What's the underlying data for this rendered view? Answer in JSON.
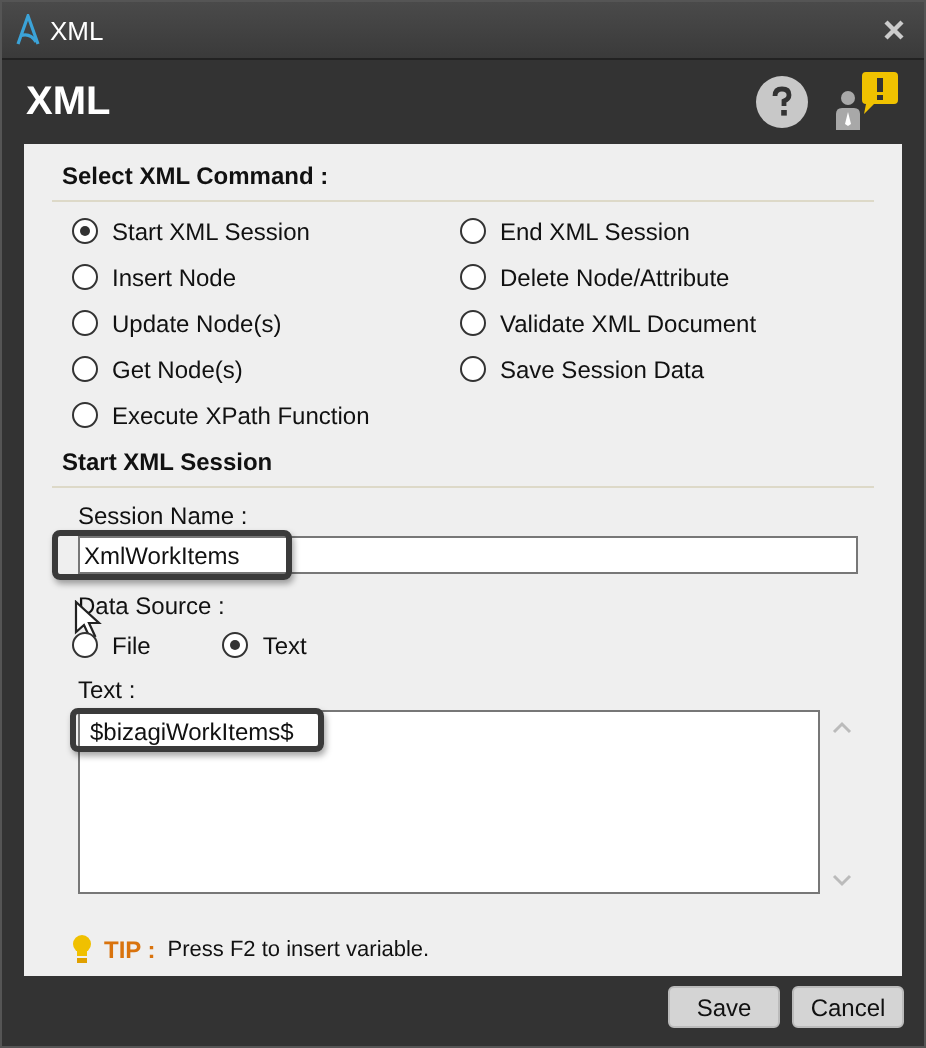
{
  "window": {
    "title": "XML"
  },
  "header": {
    "title": "XML"
  },
  "command_group": {
    "label": "Select XML Command :",
    "columns": [
      [
        {
          "label": "Start XML Session",
          "selected": true
        },
        {
          "label": "Insert Node",
          "selected": false
        },
        {
          "label": "Update Node(s)",
          "selected": false
        },
        {
          "label": "Get Node(s)",
          "selected": false
        },
        {
          "label": "Execute XPath Function",
          "selected": false
        }
      ],
      [
        {
          "label": "End XML Session",
          "selected": false
        },
        {
          "label": "Delete Node/Attribute",
          "selected": false
        },
        {
          "label": "Validate XML Document",
          "selected": false
        },
        {
          "label": "Save Session Data",
          "selected": false
        }
      ]
    ]
  },
  "section": {
    "title": "Start XML Session"
  },
  "session_name": {
    "label": "Session Name :",
    "value": "XmlWorkItems",
    "highlighted": true
  },
  "data_source": {
    "label": "Data Source :",
    "options": [
      {
        "label": "File",
        "selected": false
      },
      {
        "label": "Text",
        "selected": true
      }
    ]
  },
  "text_field": {
    "label": "Text :",
    "value": "$bizagiWorkItems$",
    "highlighted": true
  },
  "tip": {
    "label": "TIP :",
    "text": "Press F2 to insert variable."
  },
  "buttons": [
    "Save",
    "Cancel"
  ]
}
